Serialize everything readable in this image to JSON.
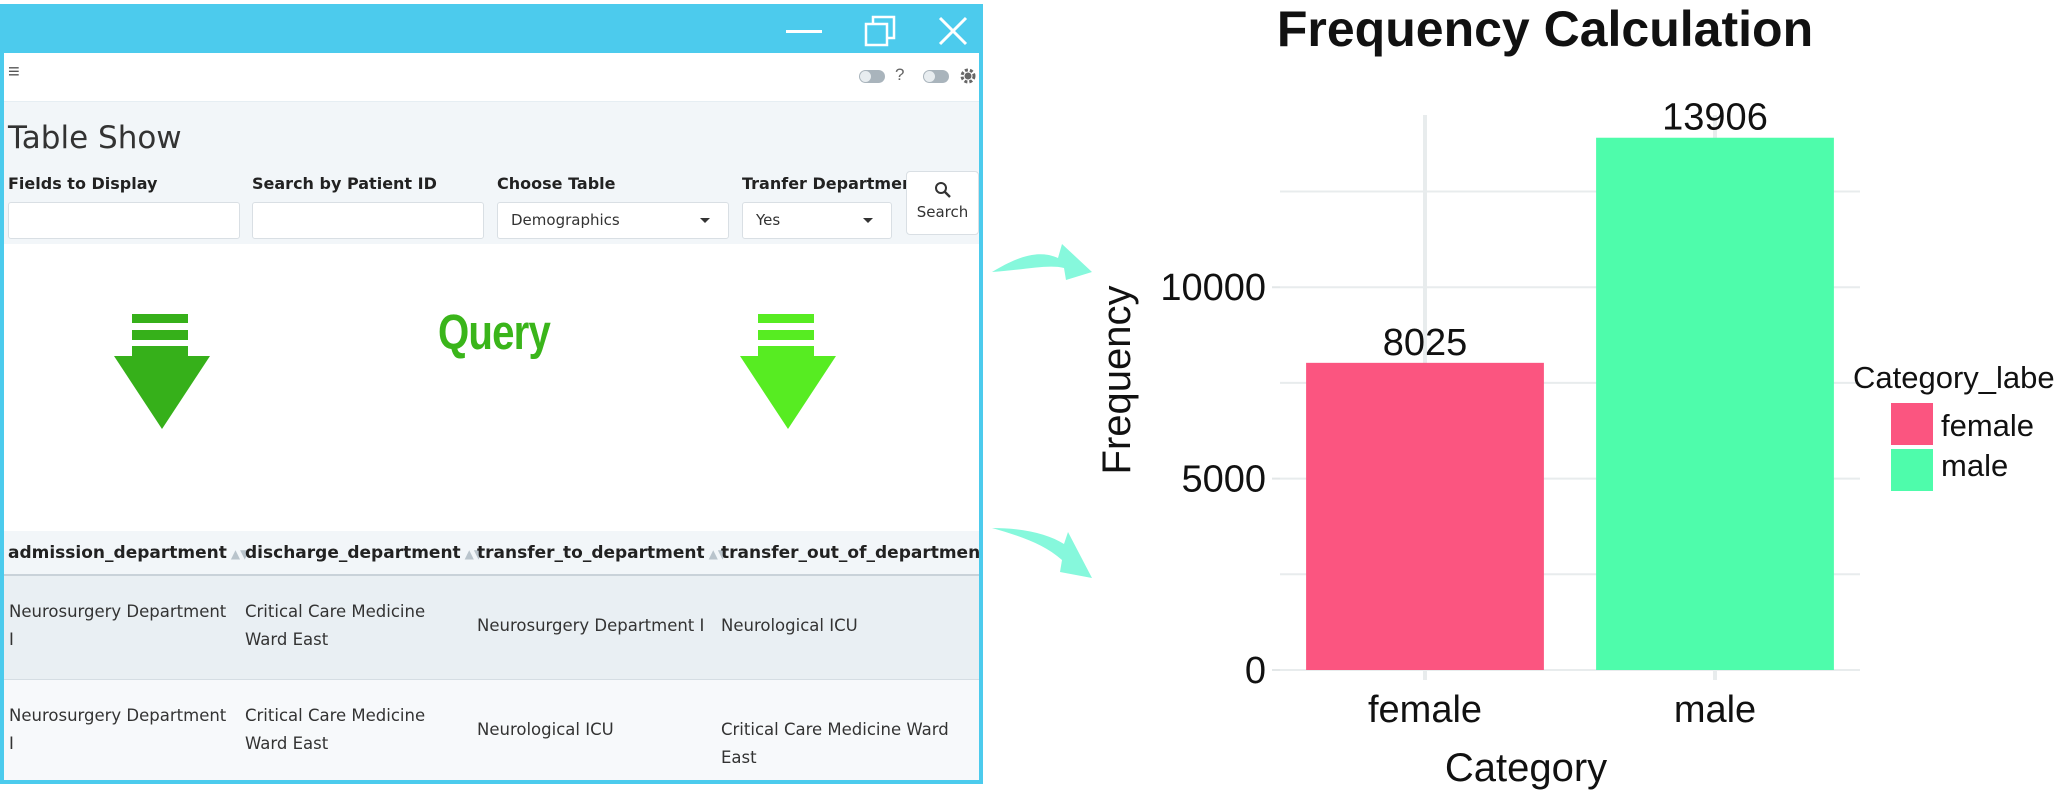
{
  "window": {
    "controls": [
      "minimize",
      "restore",
      "close"
    ],
    "accent": "#4ccbed"
  },
  "toolbar": {
    "menu_icon": "≡",
    "help_mark": "?"
  },
  "page": {
    "title": "Table Show"
  },
  "filters": {
    "fields_label": "Fields to Display",
    "fields_value": "",
    "patient_label": "Search by Patient ID",
    "patient_value": "",
    "table_label": "Choose Table",
    "table_value": "Demographics",
    "transfer_label": "Tranfer Department",
    "transfer_value": "Yes",
    "search_label": "Search"
  },
  "query_label": "Query",
  "table": {
    "columns": [
      "admission_department",
      "discharge_department",
      "transfer_to_department",
      "transfer_out_of_department"
    ],
    "rows": [
      [
        "Neurosurgery Department I",
        "Critical Care Medicine Ward East",
        "Neurosurgery Department I",
        "Neurological ICU"
      ],
      [
        "Neurosurgery Department I",
        "Critical Care Medicine Ward East",
        "Neurological ICU",
        "Critical Care Medicine Ward East"
      ]
    ]
  },
  "chart_data": {
    "type": "bar",
    "title": "Frequency Calculation",
    "xlabel": "Category",
    "ylabel": "Frequency",
    "categories": [
      "female",
      "male"
    ],
    "values": [
      8025,
      13906
    ],
    "colors": [
      "#fb5580",
      "#4efcab"
    ],
    "ylim": [
      0,
      14500
    ],
    "yticks": [
      0,
      5000,
      10000
    ],
    "legend": {
      "title": "Category_labels",
      "items": [
        "female",
        "male"
      ],
      "placement": "right"
    },
    "grid": true
  }
}
